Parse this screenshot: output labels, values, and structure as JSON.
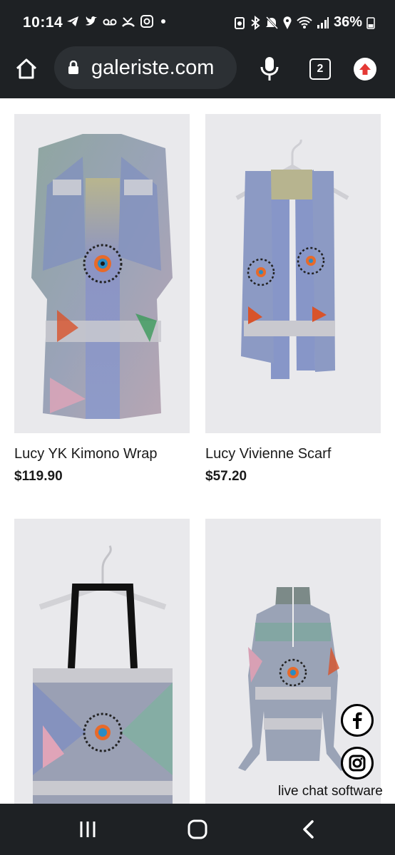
{
  "status": {
    "time": "10:14",
    "notification_icons": [
      "telegram-icon",
      "twitter-icon",
      "voicemail-icon",
      "missed-call-icon",
      "instagram-icon",
      "dot-icon"
    ],
    "system_icons": [
      "alarm-icon",
      "bluetooth-icon",
      "mute-icon",
      "location-icon",
      "wifi-icon",
      "signal-icon"
    ],
    "battery": "36%"
  },
  "browser": {
    "url": "galeriste.com",
    "tab_count": "2"
  },
  "products": [
    {
      "name": "Lucy YK Kimono Wrap",
      "price": "$119.90"
    },
    {
      "name": "Lucy Vivienne Scarf",
      "price": "$57.20"
    },
    {
      "name": "",
      "price": ""
    },
    {
      "name": "",
      "price": ""
    }
  ],
  "chat_label": "live chat software",
  "colors": {
    "bar": "#1e2124",
    "pill": "#2c3034",
    "update": "#e53935",
    "card_bg": "#e9e9ec"
  }
}
